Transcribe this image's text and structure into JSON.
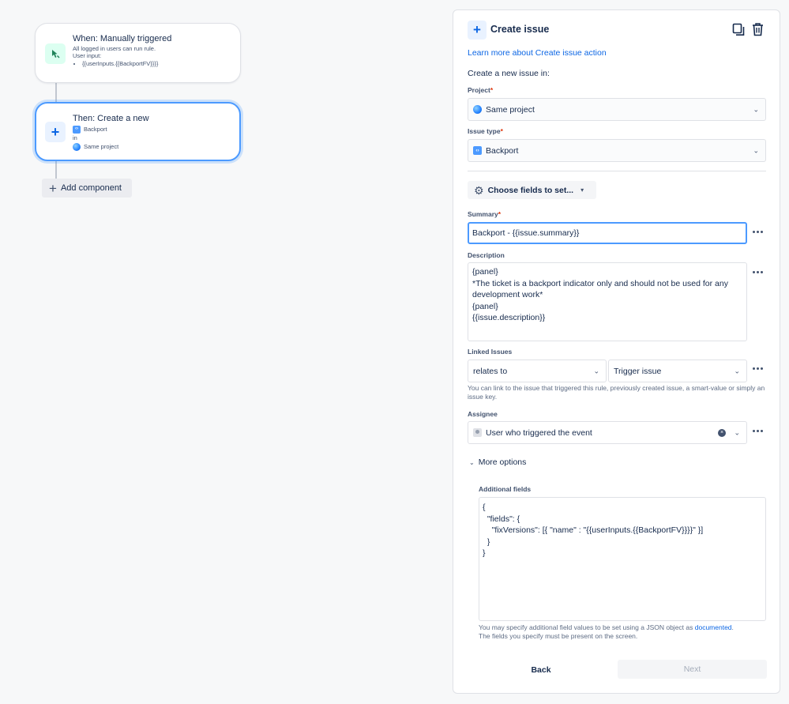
{
  "flow": {
    "trigger": {
      "title": "When: Manually triggered",
      "line1": "All logged in users can run rule.",
      "line2": "User input:",
      "bullet": "{{userInputs.{{BackportFV}}}}",
      "icon": "cursor-click-icon"
    },
    "action": {
      "title": "Then: Create a new",
      "issue_type": "Backport",
      "in_label": "in",
      "project": "Same project",
      "icon": "plus-icon"
    },
    "add_component_label": "Add component"
  },
  "panel": {
    "title": "Create issue",
    "learn_more": "Learn more about Create issue action",
    "create_in_label": "Create a new issue in:",
    "project": {
      "label": "Project",
      "required_mark": "*",
      "value": "Same project"
    },
    "issue_type": {
      "label": "Issue type",
      "required_mark": "*",
      "value": "Backport"
    },
    "choose_fields_label": "Choose fields to set...",
    "summary": {
      "label": "Summary",
      "required_mark": "*",
      "value": "Backport - {{issue.summary}}"
    },
    "description": {
      "label": "Description",
      "lines": [
        "{panel}",
        "*The ticket is a backport indicator only and should not be used for any",
        "development work*",
        "{panel}",
        "",
        "{{issue.description}}"
      ]
    },
    "linked_issues": {
      "label": "Linked Issues",
      "relation": "relates to",
      "target": "Trigger issue",
      "help": "You can link to the issue that triggered this rule, previously created issue, a smart-value or simply an issue key."
    },
    "assignee": {
      "label": "Assignee",
      "value": "User who triggered the event"
    },
    "more_options_label": "More options",
    "additional_fields": {
      "label": "Additional fields",
      "lines": [
        "{",
        "  \"fields\": {",
        "    \"fixVersions\": [{ \"name\" : \"{{userInputs.{{BackportFV}}}}\" }]",
        "  }",
        "}"
      ],
      "help_prefix": "You may specify additional field values to be set using a JSON object as ",
      "help_link": "documented",
      "help_suffix": ".",
      "help_line2": "The fields you specify must be present on the screen."
    },
    "back_label": "Back",
    "next_label": "Next"
  },
  "colors": {
    "accent": "#0c66e4",
    "focus": "#4c9aff",
    "required": "#de350b",
    "background": "#f7f8f9"
  }
}
